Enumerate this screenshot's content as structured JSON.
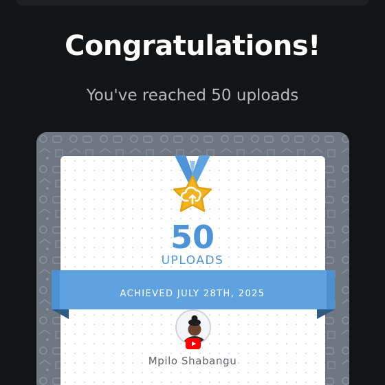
{
  "header": {
    "title": "Congratulations!",
    "subtitle": "You've reached 50 uploads"
  },
  "badge": {
    "count": "50",
    "unit": "UPLOADS",
    "achieved": "ACHIEVED JULY 28TH, 2025",
    "icon": "cloud-upload-icon"
  },
  "user": {
    "name": "Mpilo Shabangu",
    "platform_icon": "youtube-icon"
  },
  "colors": {
    "accent_blue": "#4d93d8",
    "ribbon_blue": "#5ea2e0",
    "star_gold": "#f2b31f",
    "background": "#131416"
  }
}
